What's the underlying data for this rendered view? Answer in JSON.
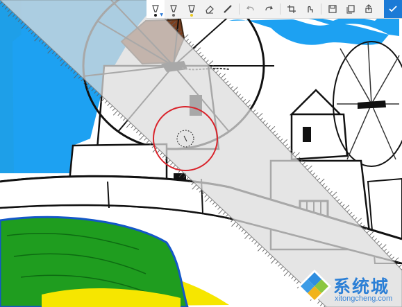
{
  "app": {
    "canvas_description_icon": "sketch-canvas"
  },
  "toolbar": {
    "tools": [
      {
        "name": "ballpoint-pen",
        "icon": "pen-icon",
        "color": "#1b1b1b"
      },
      {
        "name": "pencil",
        "icon": "pencil-icon",
        "color": "#6a6a6a"
      },
      {
        "name": "highlighter",
        "icon": "highlighter-icon",
        "color": "#e8c81e"
      },
      {
        "name": "eraser",
        "icon": "eraser-icon"
      },
      {
        "name": "ruler",
        "icon": "ruler-icon"
      }
    ],
    "history": [
      {
        "name": "undo",
        "icon": "undo-icon"
      },
      {
        "name": "redo",
        "icon": "redo-icon"
      }
    ],
    "edit": [
      {
        "name": "crop",
        "icon": "crop-icon"
      },
      {
        "name": "touch-writing",
        "icon": "touch-writing-icon"
      }
    ],
    "file": [
      {
        "name": "save",
        "icon": "save-icon"
      },
      {
        "name": "copy",
        "icon": "copy-icon"
      },
      {
        "name": "share",
        "icon": "share-icon"
      }
    ],
    "done_icon": "check-icon",
    "accent": "#1b7ad6"
  },
  "watermark": {
    "text": "系统城",
    "url": "xitongcheng.com",
    "color": "#2b7fd6"
  }
}
